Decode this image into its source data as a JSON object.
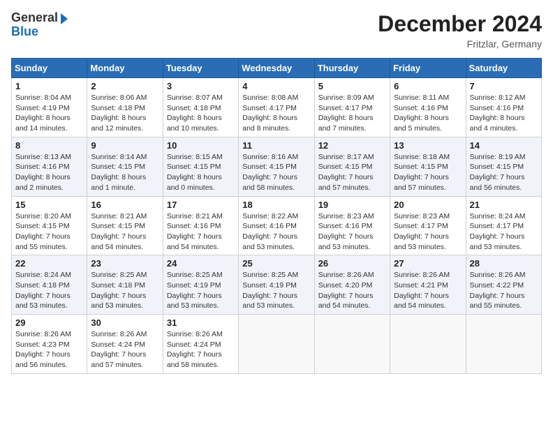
{
  "header": {
    "logo_line1": "General",
    "logo_line2": "Blue",
    "month_title": "December 2024",
    "location": "Fritzlar, Germany"
  },
  "days_of_week": [
    "Sunday",
    "Monday",
    "Tuesday",
    "Wednesday",
    "Thursday",
    "Friday",
    "Saturday"
  ],
  "weeks": [
    [
      {
        "day": "1",
        "sunrise": "8:04 AM",
        "sunset": "4:19 PM",
        "daylight": "8 hours and 14 minutes."
      },
      {
        "day": "2",
        "sunrise": "8:06 AM",
        "sunset": "4:18 PM",
        "daylight": "8 hours and 12 minutes."
      },
      {
        "day": "3",
        "sunrise": "8:07 AM",
        "sunset": "4:18 PM",
        "daylight": "8 hours and 10 minutes."
      },
      {
        "day": "4",
        "sunrise": "8:08 AM",
        "sunset": "4:17 PM",
        "daylight": "8 hours and 8 minutes."
      },
      {
        "day": "5",
        "sunrise": "8:09 AM",
        "sunset": "4:17 PM",
        "daylight": "8 hours and 7 minutes."
      },
      {
        "day": "6",
        "sunrise": "8:11 AM",
        "sunset": "4:16 PM",
        "daylight": "8 hours and 5 minutes."
      },
      {
        "day": "7",
        "sunrise": "8:12 AM",
        "sunset": "4:16 PM",
        "daylight": "8 hours and 4 minutes."
      }
    ],
    [
      {
        "day": "8",
        "sunrise": "8:13 AM",
        "sunset": "4:16 PM",
        "daylight": "8 hours and 2 minutes."
      },
      {
        "day": "9",
        "sunrise": "8:14 AM",
        "sunset": "4:15 PM",
        "daylight": "8 hours and 1 minute."
      },
      {
        "day": "10",
        "sunrise": "8:15 AM",
        "sunset": "4:15 PM",
        "daylight": "8 hours and 0 minutes."
      },
      {
        "day": "11",
        "sunrise": "8:16 AM",
        "sunset": "4:15 PM",
        "daylight": "7 hours and 58 minutes."
      },
      {
        "day": "12",
        "sunrise": "8:17 AM",
        "sunset": "4:15 PM",
        "daylight": "7 hours and 57 minutes."
      },
      {
        "day": "13",
        "sunrise": "8:18 AM",
        "sunset": "4:15 PM",
        "daylight": "7 hours and 57 minutes."
      },
      {
        "day": "14",
        "sunrise": "8:19 AM",
        "sunset": "4:15 PM",
        "daylight": "7 hours and 56 minutes."
      }
    ],
    [
      {
        "day": "15",
        "sunrise": "8:20 AM",
        "sunset": "4:15 PM",
        "daylight": "7 hours and 55 minutes."
      },
      {
        "day": "16",
        "sunrise": "8:21 AM",
        "sunset": "4:15 PM",
        "daylight": "7 hours and 54 minutes."
      },
      {
        "day": "17",
        "sunrise": "8:21 AM",
        "sunset": "4:16 PM",
        "daylight": "7 hours and 54 minutes."
      },
      {
        "day": "18",
        "sunrise": "8:22 AM",
        "sunset": "4:16 PM",
        "daylight": "7 hours and 53 minutes."
      },
      {
        "day": "19",
        "sunrise": "8:23 AM",
        "sunset": "4:16 PM",
        "daylight": "7 hours and 53 minutes."
      },
      {
        "day": "20",
        "sunrise": "8:23 AM",
        "sunset": "4:17 PM",
        "daylight": "7 hours and 53 minutes."
      },
      {
        "day": "21",
        "sunrise": "8:24 AM",
        "sunset": "4:17 PM",
        "daylight": "7 hours and 53 minutes."
      }
    ],
    [
      {
        "day": "22",
        "sunrise": "8:24 AM",
        "sunset": "4:18 PM",
        "daylight": "7 hours and 53 minutes."
      },
      {
        "day": "23",
        "sunrise": "8:25 AM",
        "sunset": "4:18 PM",
        "daylight": "7 hours and 53 minutes."
      },
      {
        "day": "24",
        "sunrise": "8:25 AM",
        "sunset": "4:19 PM",
        "daylight": "7 hours and 53 minutes."
      },
      {
        "day": "25",
        "sunrise": "8:25 AM",
        "sunset": "4:19 PM",
        "daylight": "7 hours and 53 minutes."
      },
      {
        "day": "26",
        "sunrise": "8:26 AM",
        "sunset": "4:20 PM",
        "daylight": "7 hours and 54 minutes."
      },
      {
        "day": "27",
        "sunrise": "8:26 AM",
        "sunset": "4:21 PM",
        "daylight": "7 hours and 54 minutes."
      },
      {
        "day": "28",
        "sunrise": "8:26 AM",
        "sunset": "4:22 PM",
        "daylight": "7 hours and 55 minutes."
      }
    ],
    [
      {
        "day": "29",
        "sunrise": "8:26 AM",
        "sunset": "4:23 PM",
        "daylight": "7 hours and 56 minutes."
      },
      {
        "day": "30",
        "sunrise": "8:26 AM",
        "sunset": "4:24 PM",
        "daylight": "7 hours and 57 minutes."
      },
      {
        "day": "31",
        "sunrise": "8:26 AM",
        "sunset": "4:24 PM",
        "daylight": "7 hours and 58 minutes."
      },
      null,
      null,
      null,
      null
    ]
  ]
}
